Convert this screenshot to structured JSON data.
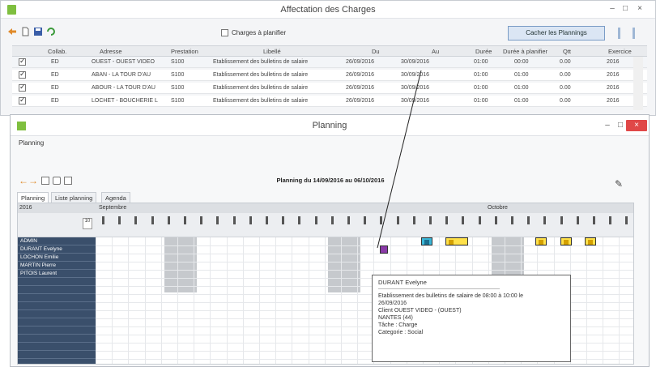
{
  "top_window": {
    "title": "Affectation des Charges",
    "controls": {
      "minimize": "–",
      "maximize": "□",
      "close": "×"
    },
    "charges_checkbox_label": "Charges à planifier",
    "hide_button_label": "Cacher les Plannings",
    "columns": [
      "Collab.",
      "Adresse",
      "Prestation",
      "Libellé",
      "Du",
      "Au",
      "Durée",
      "Durée à planifier",
      "Qtt",
      "Exercice"
    ],
    "rows": [
      {
        "collab": "ED",
        "adresse": "OUEST - OUEST VIDEO",
        "prestation": "S100",
        "libelle": "Etablissement des bulletins de salaire",
        "du": "26/09/2016",
        "au": "30/09/2016",
        "duree": "01:00",
        "duree_planif": "00:00",
        "qtt": "0.00",
        "exercice": "2016"
      },
      {
        "collab": "ED",
        "adresse": "ABAN - LA TOUR D'AU",
        "prestation": "S100",
        "libelle": "Etablissement des bulletins de salaire",
        "du": "26/09/2016",
        "au": "30/09/2016",
        "duree": "01:00",
        "duree_planif": "01:00",
        "qtt": "0.00",
        "exercice": "2016"
      },
      {
        "collab": "ED",
        "adresse": "ABOUR - LA TOUR D'AU",
        "prestation": "S100",
        "libelle": "Etablissement des bulletins de salaire",
        "du": "26/09/2016",
        "au": "30/09/2016",
        "duree": "01:00",
        "duree_planif": "01:00",
        "qtt": "0.00",
        "exercice": "2016"
      },
      {
        "collab": "ED",
        "adresse": "LOCHET - BOUCHERIE L",
        "prestation": "S100",
        "libelle": "Etablissement des bulletins de salaire",
        "du": "26/09/2016",
        "au": "30/09/2016",
        "duree": "01:00",
        "duree_planif": "01:00",
        "qtt": "0.00",
        "exercice": "2016"
      }
    ]
  },
  "planning_window": {
    "title": "Planning",
    "menu_label": "Planning",
    "range_title": "Planning du 14/09/2016 au 06/10/2016",
    "tabs": [
      "Planning",
      "Liste planning",
      "Agenda"
    ],
    "year": "2016",
    "months": [
      "Septembre",
      "Octobre"
    ],
    "resources": [
      "ADMIN",
      "DURANT Evelyne",
      "LOCHON Emilie",
      "MARTIN Pierre",
      "PITOIS Laurent"
    ],
    "tooltip": {
      "name": "DURANT Evelyne",
      "lines": [
        "Etablissement des bulletins de salaire de 08:00 à 10:00 le",
        "26/09/2016",
        "Client OUEST VIDEO - (OUEST)",
        "NANTES (44)",
        "Tâche : Charge",
        "Categorie : Social"
      ]
    }
  },
  "colors": {
    "accent_blue": "#7a9cc6",
    "resource_bg": "#3a4f6b",
    "event_purple": "#8a3aa8",
    "event_cyan": "#3ab7d8",
    "event_yellow": "#ffe14a",
    "close_red": "#e04848"
  }
}
